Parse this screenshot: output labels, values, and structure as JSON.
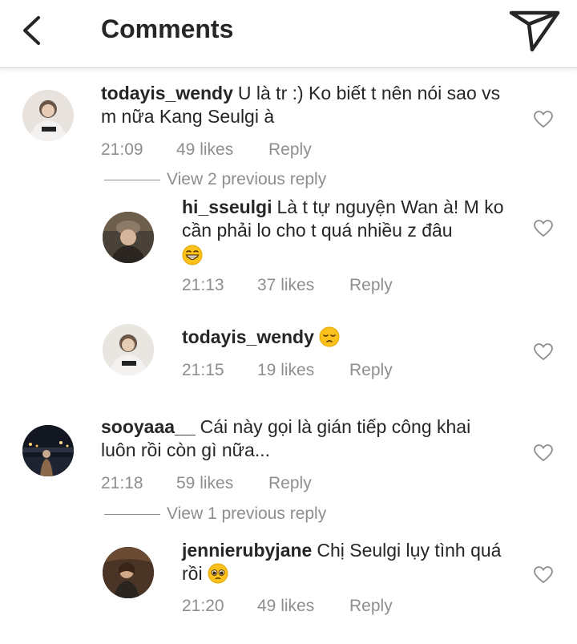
{
  "header": {
    "title": "Comments"
  },
  "comments": [
    {
      "username": "todayis_wendy",
      "text": "U là tr :) Ko biết t nên nói sao vs m nữa Kang Seulgi à",
      "time": "21:09",
      "likes": "49 likes",
      "reply": "Reply"
    },
    {
      "view_replies": "View 2 previous reply"
    },
    {
      "username": "hi_sseulgi",
      "text": "Là t tự nguyện Wan à! M ko cần phải lo cho t quá nhiều z đâu",
      "emoji": "grinning-face",
      "time": "21:13",
      "likes": "37 likes",
      "reply": "Reply"
    },
    {
      "username": "todayis_wendy",
      "text": "",
      "emoji": "pensive-face",
      "time": "21:15",
      "likes": "19 likes",
      "reply": "Reply"
    },
    {
      "username": "sooyaaa__",
      "text": "Cái này gọi là gián tiếp công khai luôn rồi còn gì nữa...",
      "time": "21:18",
      "likes": "59 likes",
      "reply": "Reply"
    },
    {
      "view_replies": "View 1 previous reply"
    },
    {
      "username": "jennierubyjane",
      "text": "Chị Seulgi lụy tình quá rồi",
      "emoji": "pleading-face",
      "time": "21:20",
      "likes": "49 likes",
      "reply": "Reply"
    }
  ],
  "colors": {
    "text": "#262626",
    "secondary": "#8e8e8e",
    "divider": "#dbdbdb"
  }
}
